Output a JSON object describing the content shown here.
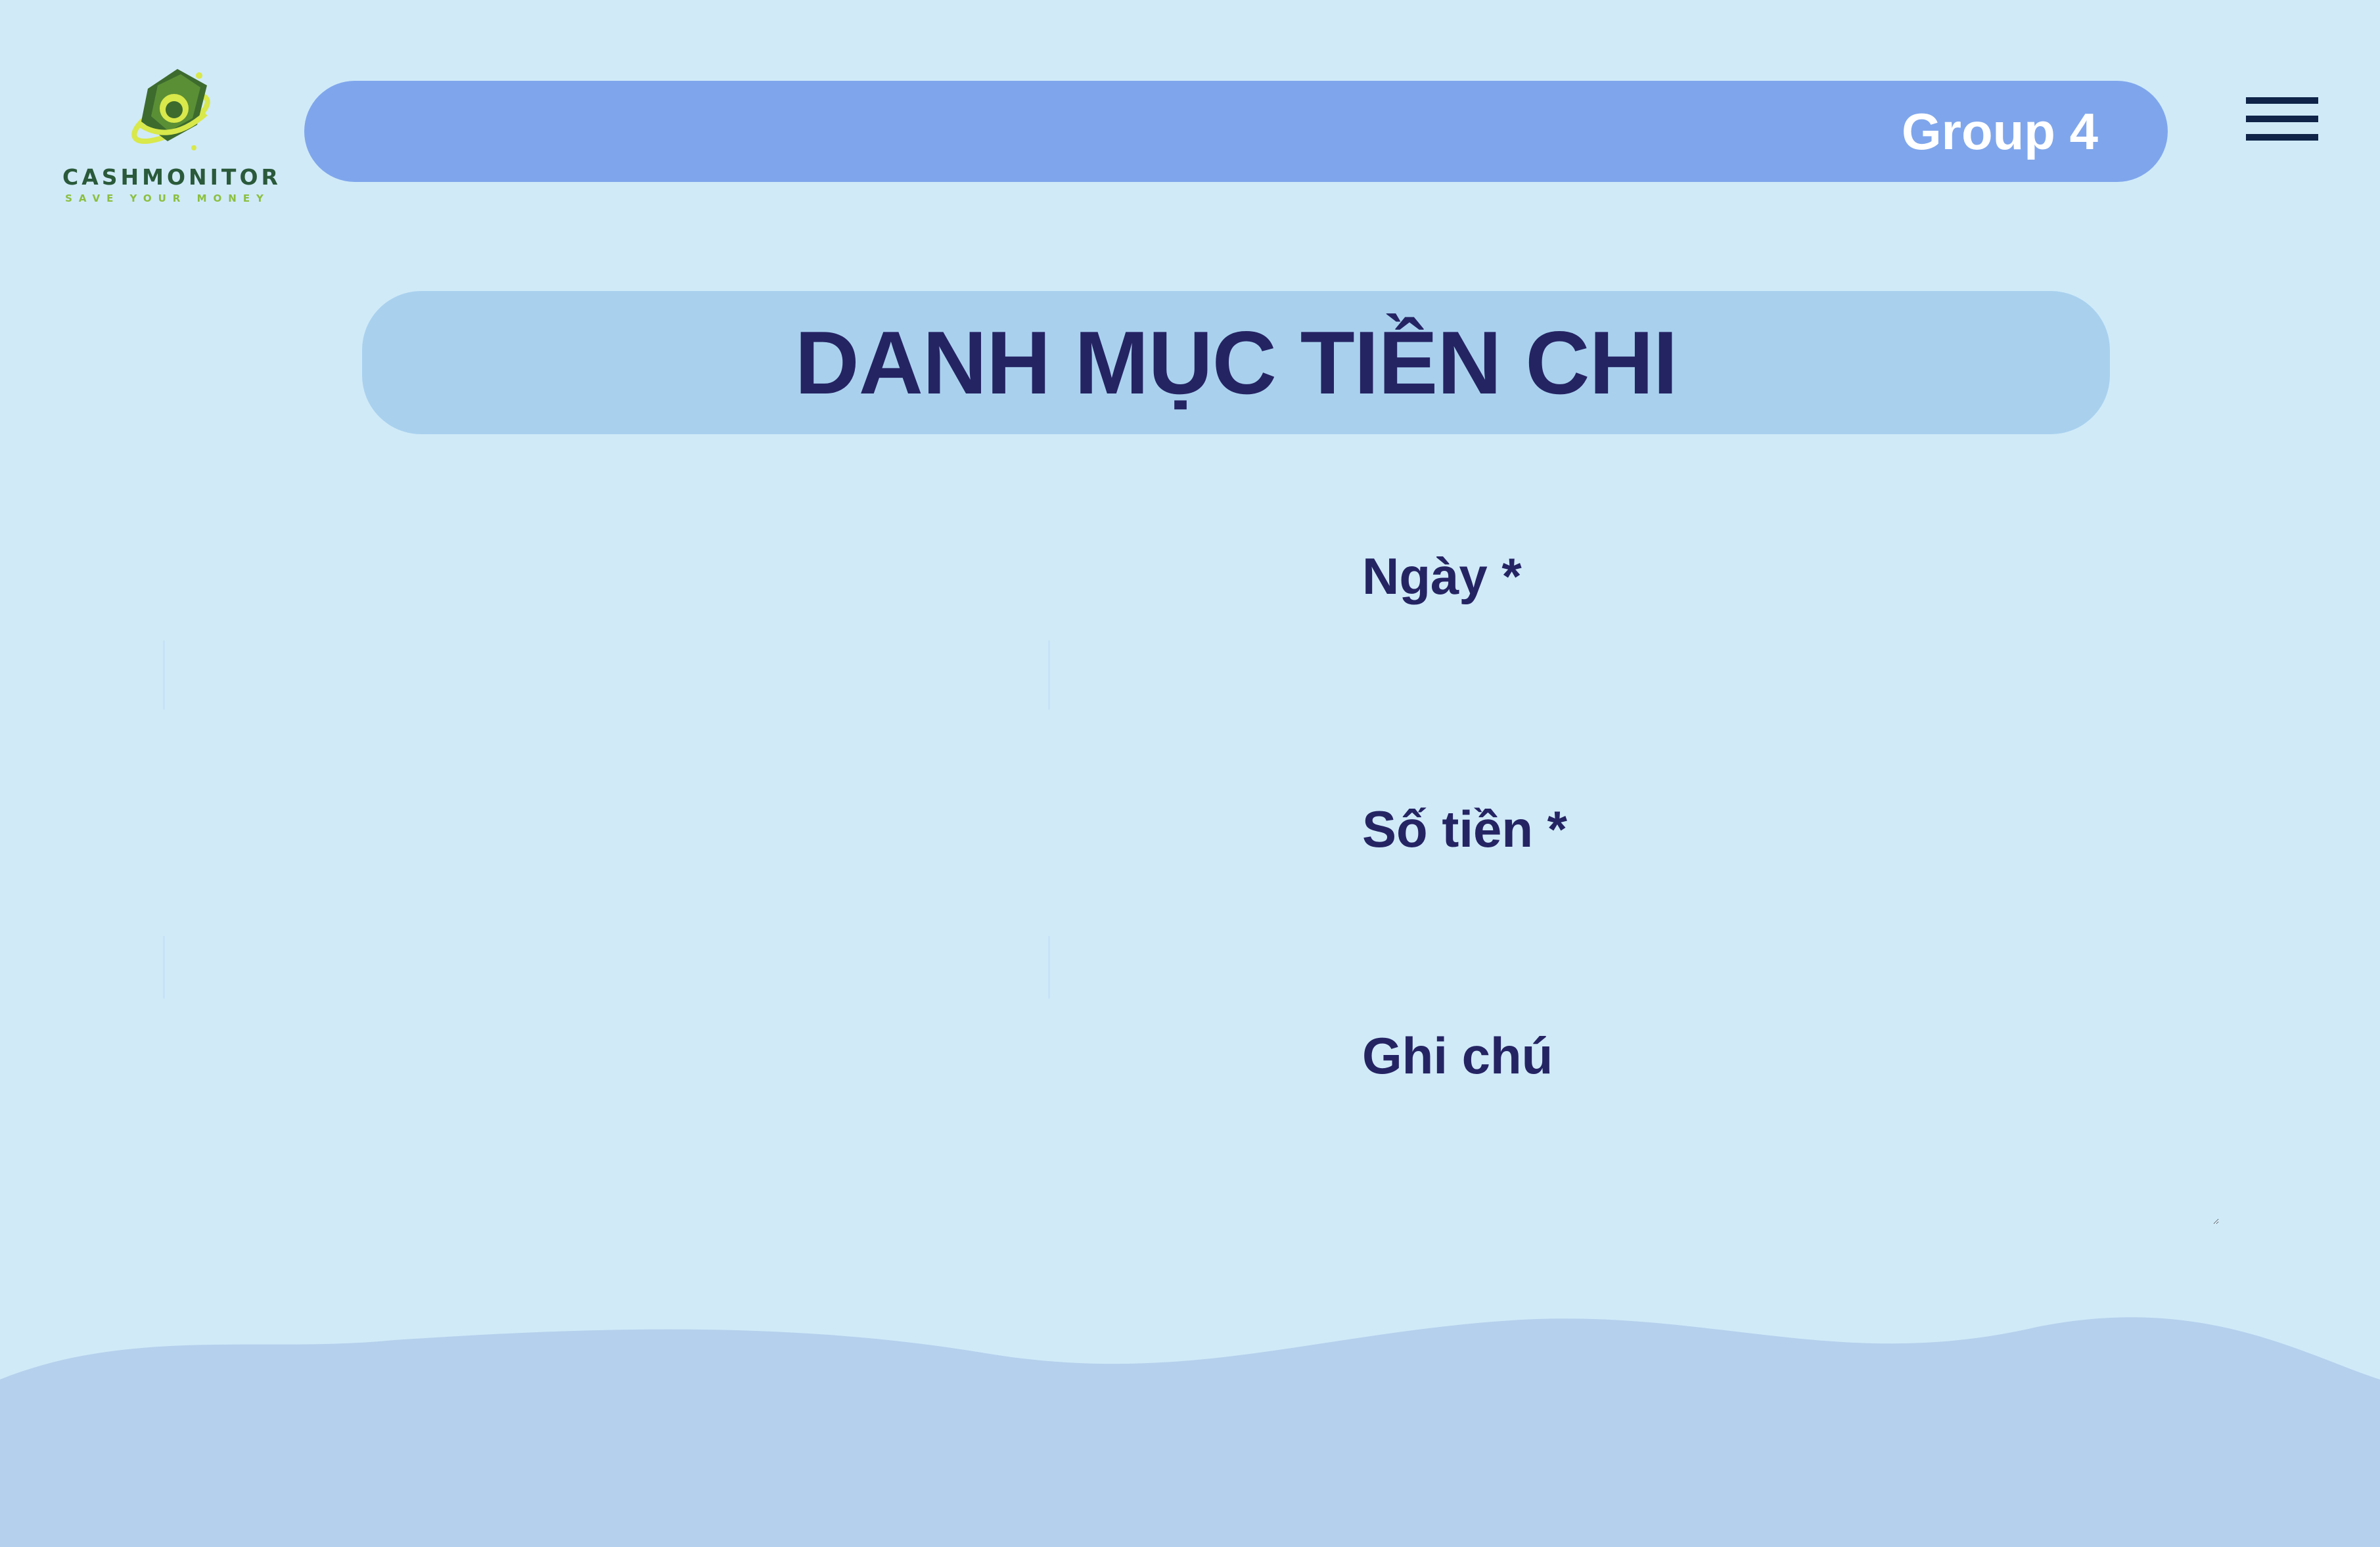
{
  "brand": {
    "name": "CASHMONITOR",
    "tagline": "SAVE YOUR MONEY"
  },
  "header": {
    "group_label": "Group 4"
  },
  "page": {
    "title": "DANH MỤC TIỀN CHI"
  },
  "form": {
    "date_label": "Ngày *",
    "date_value": "",
    "amount_label": "Số tiền *",
    "amount_value": "",
    "note_label": "Ghi chú",
    "note_value": ""
  },
  "icons": {
    "logo": "cash-globe-logo-icon",
    "menu": "hamburger-menu-icon"
  },
  "colors": {
    "background": "#d0eaf8",
    "topbar": "#7fa6ec",
    "title_box": "#a9d1ee",
    "title_text": "#252463",
    "wave": "#b5d0ec",
    "menu_icon": "#0f2448"
  }
}
